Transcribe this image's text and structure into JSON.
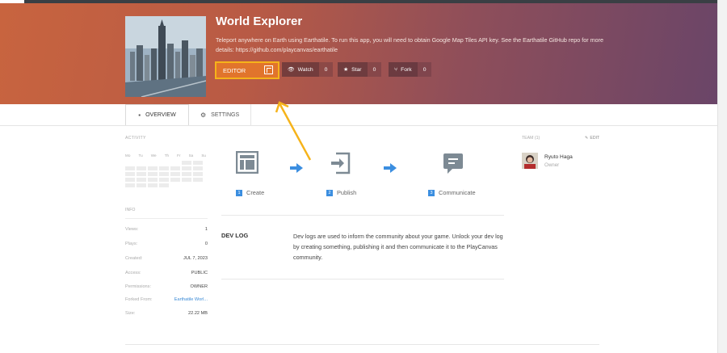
{
  "project": {
    "title": "World Explorer",
    "description": "Teleport anywhere on Earth using Earthatile. To run this app, you will need to obtain Google Map Tiles API key. See the Earthatile GitHub repo for more details: https://github.com/playcanvas/earthatile"
  },
  "actions": {
    "editor_label": "EDITOR",
    "watch_label": "Watch",
    "watch_count": "0",
    "star_label": "Star",
    "star_count": "0",
    "fork_label": "Fork",
    "fork_count": "0"
  },
  "tabs": [
    {
      "label": "OVERVIEW",
      "icon": "speech-bubble-icon",
      "active": true
    },
    {
      "label": "SETTINGS",
      "icon": "gear-icon",
      "active": false
    }
  ],
  "activity": {
    "heading": "ACTIVITY",
    "days": [
      "Mo",
      "Tu",
      "We",
      "Th",
      "Fr",
      "Sa",
      "Su"
    ]
  },
  "info": {
    "heading": "INFO",
    "rows": [
      {
        "key": "Views:",
        "value": "1"
      },
      {
        "key": "Plays:",
        "value": "0"
      },
      {
        "key": "Created:",
        "value": "JUL 7, 2023"
      },
      {
        "key": "Access:",
        "value": "PUBLIC"
      },
      {
        "key": "Permissions:",
        "value": "OWNER"
      },
      {
        "key": "Forked From:",
        "value": "Earthatile Worl..."
      },
      {
        "key": "Size:",
        "value": "22.22 MB"
      }
    ]
  },
  "steps": [
    {
      "num": "1",
      "label": "Create",
      "icon": "layout-icon"
    },
    {
      "num": "2",
      "label": "Publish",
      "icon": "publish-icon"
    },
    {
      "num": "3",
      "label": "Communicate",
      "icon": "chat-icon"
    }
  ],
  "devlog": {
    "heading": "DEV LOG",
    "text": "Dev logs are used to inform the community about your game. Unlock your dev log by creating something, publishing it and then communicate it to the PlayCanvas community."
  },
  "team": {
    "heading": "TEAM (1)",
    "edit_label": "EDIT",
    "members": [
      {
        "name": "Ryuto Haga",
        "role": "Owner"
      }
    ]
  },
  "colors": {
    "accent": "#3b8ee0",
    "editor_button": "#e1742c",
    "highlight": "#f6b31a"
  }
}
